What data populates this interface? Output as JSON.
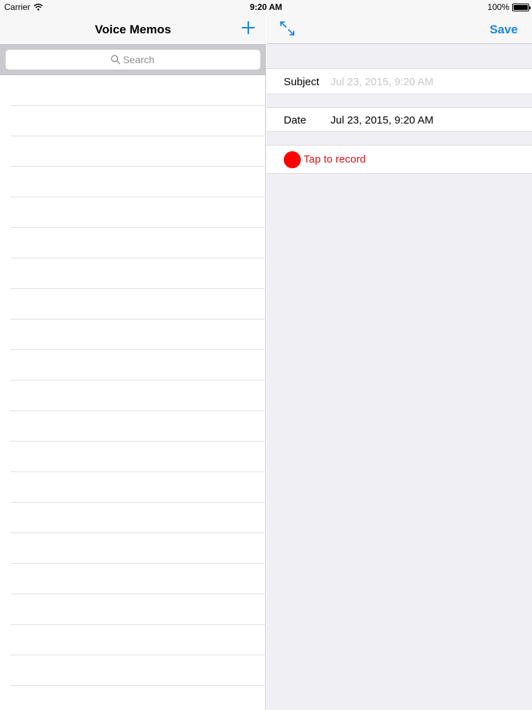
{
  "status_bar": {
    "carrier": "Carrier",
    "time": "9:20 AM",
    "battery": "100%",
    "battery_level": 1.0
  },
  "master": {
    "title": "Voice Memos",
    "add_icon": "plus-icon",
    "search": {
      "placeholder": "Search",
      "value": "",
      "icon": "search-icon"
    },
    "row_count": 21
  },
  "detail": {
    "expand_icon": "expand-arrows-icon",
    "save_label": "Save",
    "subject": {
      "label": "Subject",
      "placeholder": "Jul 23, 2015, 9:20 AM",
      "value": ""
    },
    "date": {
      "label": "Date",
      "value": "Jul 23, 2015, 9:20 AM"
    },
    "record": {
      "label": "Tap to record",
      "icon": "record-dot-icon"
    }
  },
  "colors": {
    "tint": "#1a84e0",
    "record_red": "#ff0000",
    "record_text": "#e0111b",
    "group_background": "#efeff4",
    "search_bar_background": "#c9c9ce"
  }
}
